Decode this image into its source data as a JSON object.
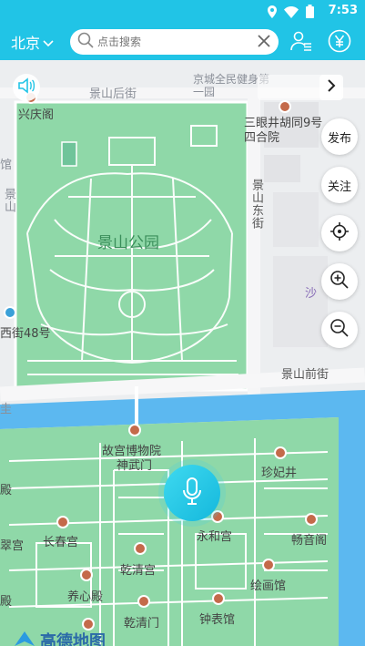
{
  "status": {
    "time": "7:53"
  },
  "header": {
    "city": "北京",
    "search_placeholder": "点击搜索"
  },
  "map_labels": {
    "jingshan_houjie": "景山后街",
    "xingqingge": "兴庆阁",
    "jingcheng_kindergarten": "京城全民健身第一园",
    "sanyan_hutong": "三眼井胡同9号四合院",
    "jingshan_park": "景山公园",
    "jingshan_dongjie": "景山东街",
    "jingshan_qianjie": "景山前街",
    "shaxing": "沙",
    "xijie48": "西街48号",
    "palace_museum": "故宫博物院",
    "shenwumen": "神武门",
    "zhenfei_well": "珍妃井",
    "changchun_palace": "长春宫",
    "yonghe_palace": "永和宫",
    "changyinge": "畅音阁",
    "qianqing_palace": "乾清宫",
    "yangxin_hall": "养心殿",
    "huihua_hall": "绘画馆",
    "qianqing_gate": "乾清门",
    "clock_hall": "钟表馆",
    "left_edge_1": "馆",
    "left_edge_2": "景山",
    "left_edge_3": "殿",
    "left_edge_4": "翠宫",
    "left_edge_5": "殿",
    "left_edge_6": "圭"
  },
  "controls": {
    "publish": "发布",
    "follow": "关注"
  },
  "logo_text": "高德地图",
  "icons": [
    "location-icon",
    "wifi-icon",
    "battery-icon",
    "chevron-down-icon",
    "search-icon",
    "close-icon",
    "user-list-icon",
    "yen-icon",
    "speaker-icon",
    "chevron-right-icon",
    "locate-icon",
    "zoom-in-icon",
    "zoom-out-icon",
    "microphone-icon"
  ],
  "colors": {
    "brand": "#21c4e6",
    "park": "#8fd8a8",
    "water": "#5cb8f0"
  }
}
